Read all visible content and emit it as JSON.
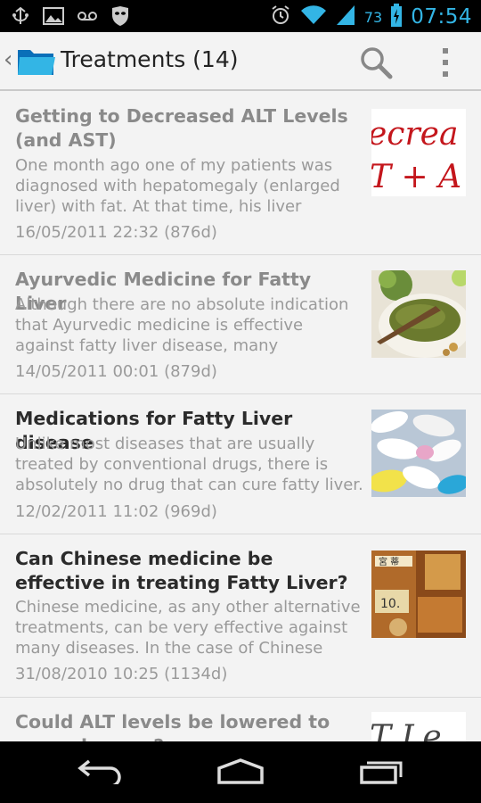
{
  "status_bar": {
    "battery_percent": "73",
    "time": "07:54",
    "icons": [
      "usb-debug-icon",
      "image-notification-icon",
      "voicemail-icon",
      "mask-icon",
      "alarm-icon",
      "wifi-icon",
      "signal-icon",
      "battery-charging-icon"
    ]
  },
  "action_bar": {
    "title": "Treatments (14)",
    "icons": [
      "up-caret-icon",
      "folder-icon",
      "search-icon",
      "overflow-menu-icon"
    ]
  },
  "articles": [
    {
      "title": "Getting to Decreased ALT Levels (and AST)",
      "snippet": "One month ago one of my patients was diagnosed with hepatomegaly (enlarged liver) with fat. At that time, his liver function",
      "date": "16/05/2011 22:32 (876d)",
      "read": true,
      "thumb_text_1": "ecrea",
      "thumb_text_2": "T + A"
    },
    {
      "title": "Ayurvedic Medicine for Fatty Liver",
      "snippet": "Although there are no absolute indication that Ayurvedic medicine is effective against fatty liver disease, many researches around",
      "date": "14/05/2011 00:01 (879d)",
      "read": true
    },
    {
      "title": "Medications for Fatty Liver disease",
      "snippet": "Unlike most diseases that are usually treated by conventional drugs, there is absolutely no drug that can cure fatty liver.",
      "date": "12/02/2011 11:02 (969d)",
      "read": false
    },
    {
      "title": "Can Chinese medicine be effective in treating Fatty Liver?",
      "snippet": "Chinese medicine, as any other alternative treatments, can be very effective against many diseases. In the case of Chinese",
      "date": "31/08/2010 10:25 (1134d)",
      "read": false,
      "thumb_text_1": "宮 蒂",
      "thumb_text_2": "10."
    },
    {
      "title": "Could ALT levels be lowered to normal range?",
      "read": true,
      "thumb_text_1": "T Le"
    }
  ],
  "nav_bar": {
    "icons": [
      "back-icon",
      "home-icon",
      "recent-apps-icon"
    ]
  }
}
